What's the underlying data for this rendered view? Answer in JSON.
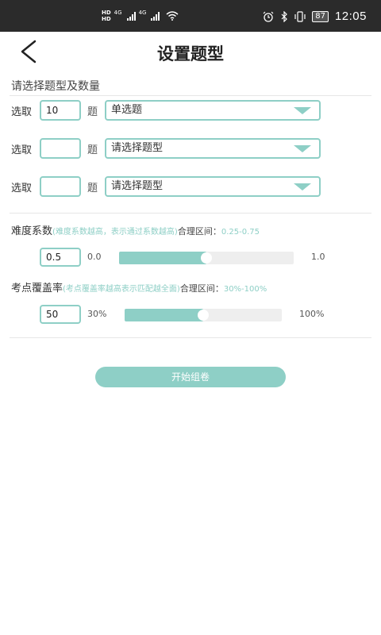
{
  "status_bar": {
    "hd1": "HD",
    "hd2": "HD",
    "net1": "4G",
    "net2": "4G",
    "battery": "87",
    "time": "12:05"
  },
  "header": {
    "title": "设置题型"
  },
  "section": {
    "label": "请选择题型及数量"
  },
  "rows": [
    {
      "prefix": "选取",
      "count": "10",
      "suffix": "题",
      "type": "单选题"
    },
    {
      "prefix": "选取",
      "count": "",
      "suffix": "题",
      "type": "请选择题型"
    },
    {
      "prefix": "选取",
      "count": "",
      "suffix": "题",
      "type": "请选择题型"
    }
  ],
  "difficulty": {
    "label": "难度系数",
    "hint": "(难度系数越高，表示通过系数越高)",
    "range_label": "合理区间：",
    "range_value": "0.25-0.75",
    "value": "0.5",
    "min": "0.0",
    "max": "1.0",
    "fraction": 0.5
  },
  "coverage": {
    "label": "考点覆盖率",
    "hint": "(考点覆盖率越高表示匹配越全面)",
    "range_label": "合理区间：",
    "range_value": "30%-100%",
    "value": "50",
    "min": "30%",
    "max": "100%",
    "fraction": 0.5
  },
  "start_button": {
    "label": "开始组卷"
  },
  "colors": {
    "accent": "#8ecfc6",
    "status_bar": "#2b2b2b"
  }
}
